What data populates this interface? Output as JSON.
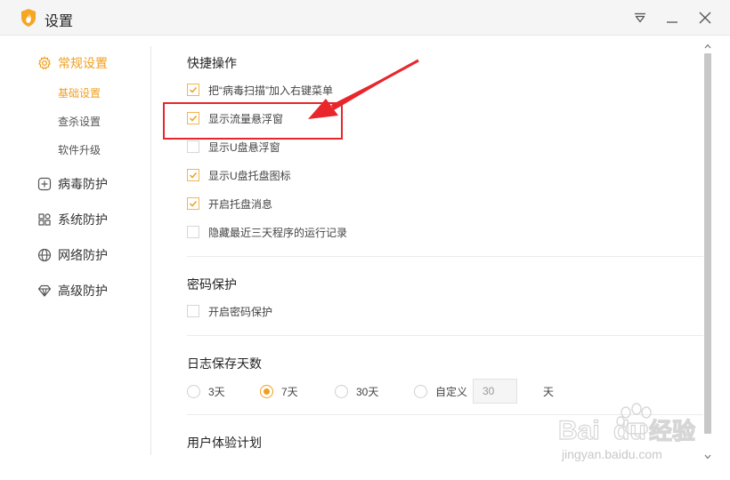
{
  "window": {
    "title": "设置",
    "logo_icon": "shield-flame-icon",
    "controls": [
      "menu-triangle-icon",
      "minimize-icon",
      "close-icon"
    ]
  },
  "sidebar": {
    "groups": [
      {
        "label": "常规设置",
        "icon": "gear-icon",
        "active": true,
        "subs": [
          {
            "label": "基础设置",
            "active": true
          },
          {
            "label": "查杀设置",
            "active": false
          },
          {
            "label": "软件升级",
            "active": false
          }
        ]
      },
      {
        "label": "病毒防护",
        "icon": "plus-square-icon"
      },
      {
        "label": "系统防护",
        "icon": "grid-icon"
      },
      {
        "label": "网络防护",
        "icon": "globe-icon"
      },
      {
        "label": "高级防护",
        "icon": "diamond-icon"
      }
    ]
  },
  "main": {
    "quick_ops": {
      "title": "快捷操作",
      "items": [
        {
          "label": "把“病毒扫描”加入右键菜单",
          "checked": true
        },
        {
          "label": "显示流量悬浮窗",
          "checked": true
        },
        {
          "label": "显示U盘悬浮窗",
          "checked": false
        },
        {
          "label": "显示U盘托盘图标",
          "checked": true
        },
        {
          "label": "开启托盘消息",
          "checked": true
        },
        {
          "label": "隐藏最近三天程序的运行记录",
          "checked": false
        }
      ]
    },
    "password": {
      "title": "密码保护",
      "items": [
        {
          "label": "开启密码保护",
          "checked": false
        }
      ]
    },
    "log_days": {
      "title": "日志保存天数",
      "options": [
        {
          "label": "3天",
          "selected": false
        },
        {
          "label": "7天",
          "selected": true
        },
        {
          "label": "30天",
          "selected": false
        },
        {
          "label": "自定义",
          "selected": false
        }
      ],
      "custom_value": "30",
      "unit": "天"
    },
    "user_exp": {
      "title": "用户体验计划"
    }
  },
  "annotation": {
    "color": "#e8262b"
  },
  "watermark": {
    "line1": "Bai du 经验",
    "line2": "jingyan.baidu.com"
  },
  "colors": {
    "accent": "#f0a020",
    "titlebar": "#f5f5f5"
  }
}
